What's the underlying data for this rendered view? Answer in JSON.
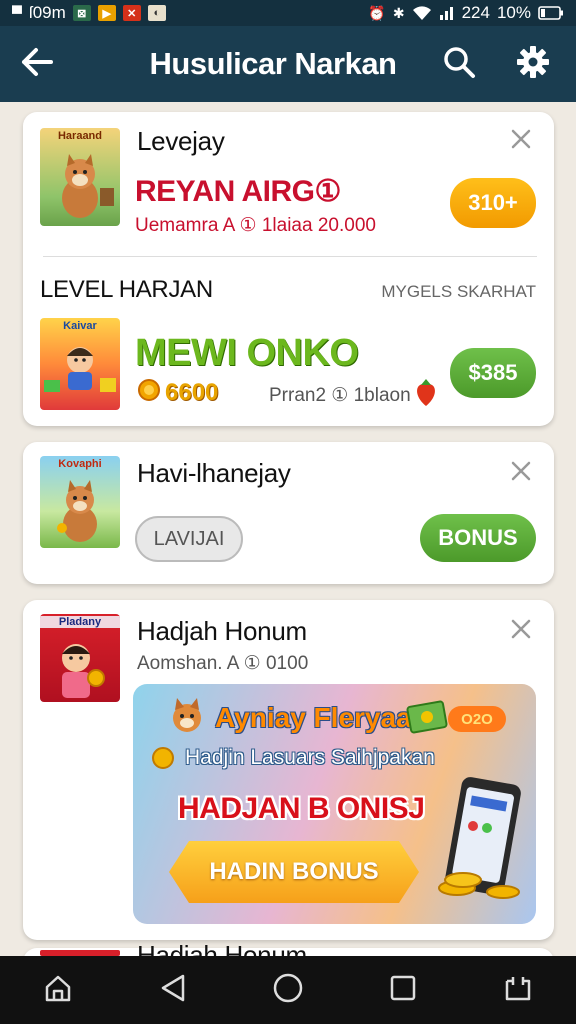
{
  "status_bar": {
    "left_text": "ſ09m",
    "time": "224",
    "battery": "10%",
    "icons": [
      "notification-icon",
      "notification-icon",
      "notification-icon",
      "notification-icon",
      "alarm-icon",
      "signal-icon",
      "wifi-icon",
      "battery-icon"
    ]
  },
  "appbar": {
    "title": "Husulicar Narkan",
    "icons": [
      "back-arrow-icon",
      "search-icon",
      "gear-icon"
    ]
  },
  "cards": {
    "first": {
      "item1": {
        "thumb_label": "Haraand",
        "title": "Levejay",
        "headline": "REYAN AIRG①",
        "sub": "Uemamra A ① 1laiaa 20.000",
        "price": "310+"
      },
      "section_label": "LEVEL HARJAN",
      "section_right": "MYGELS SKARHAT",
      "item2": {
        "thumb_label": "Kaivar",
        "title": "MEWI ONKO",
        "coins": "6600",
        "sub": "Prran2 ① 1blaon",
        "price": "$385"
      }
    },
    "second": {
      "thumb_label": "Kovaphi",
      "title": "Havi-lhanejay",
      "secondary_btn": "LAVIJAI",
      "primary_btn": "BONUS"
    },
    "third": {
      "thumb_label": "Pladany",
      "title": "Hadjah Honum",
      "sub": "Aomshan. A ① 0100",
      "banner": {
        "title": "Ayniay Fleryaa!",
        "tag": "O2O",
        "sub": "Hadjin Lasuars Saihjpakan",
        "headline": "HADJAN B ONISJ",
        "cta": "HADIN BONUS"
      }
    },
    "partial_title": "Hadjah Honum"
  },
  "navbar": {
    "icons": [
      "home-icon",
      "back-triangle-icon",
      "home-circle-icon",
      "recents-square-icon",
      "screenshot-icon"
    ]
  },
  "colors": {
    "appbar": "#1a3d50",
    "status_bar": "#14303f",
    "orange_pill": "#f6a300",
    "green_pill": "#5cab3a",
    "headline_red": "#c8102e",
    "headline_green": "#6cb81e"
  }
}
